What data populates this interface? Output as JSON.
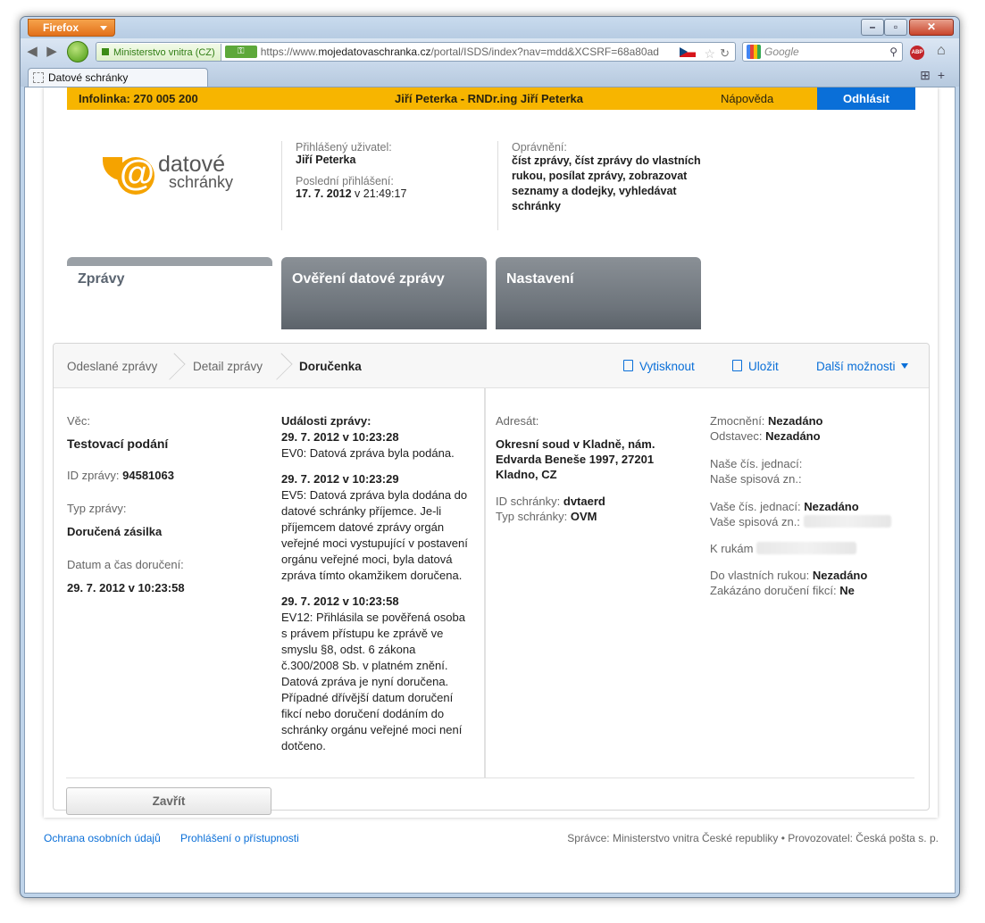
{
  "browser": {
    "app_button": "Firefox",
    "site_identity": "Ministerstvo vnitra (CZ)",
    "url_prefix": "https://www.",
    "url_domain": "mojedatovaschranka.cz",
    "url_rest": "/portal/ISDS/index?nav=mdd&XCSRF=68a80ad",
    "search_placeholder": "Google",
    "tab_title": "Datové schránky"
  },
  "topstrip": {
    "infoline": "Infolinka: 270 005 200",
    "user": "Jiří Peterka - RNDr.ing Jiří Peterka",
    "help": "Nápověda",
    "logout": "Odhlásit"
  },
  "logo": {
    "line1": "datové",
    "line2": "schránky"
  },
  "user_info": {
    "logged_label": "Přihlášený uživatel:",
    "logged_value": "Jiří Peterka",
    "last_label": "Poslední přihlášení:",
    "last_date": "17. 7. 2012",
    "last_time": " v 21:49:17",
    "rights_label": "Oprávnění:",
    "rights_value": "číst zprávy, číst zprávy do vlastních rukou, posílat zprávy, zobrazovat seznamy a dodejky, vyhledávat schránky"
  },
  "nav_tabs": [
    "Zprávy",
    "Ověření datové zprávy",
    "Nastavení"
  ],
  "breadcrumb": [
    "Odeslané zprávy",
    "Detail zprávy",
    "Doručenka"
  ],
  "actions": {
    "print": "Vytisknout",
    "save": "Uložit",
    "more": "Další možnosti"
  },
  "message": {
    "subject_label": "Věc:",
    "subject": "Testovací podání",
    "id_label": "ID zprávy:",
    "id": "94581063",
    "type_label": "Typ zprávy:",
    "type": "Doručená zásilka",
    "delivered_label": "Datum a čas doručení:",
    "delivered": "29. 7. 2012 v 10:23:58"
  },
  "events": {
    "title": "Události zprávy:",
    "items": [
      {
        "time": "29. 7. 2012 v 10:23:28",
        "text": "EV0: Datová zpráva byla podána."
      },
      {
        "time": "29. 7. 2012 v 10:23:29",
        "text": "EV5: Datová zpráva byla dodána do datové schránky příjemce. Je-li příjemcem datové zprávy orgán veřejné moci vystupující v postavení orgánu veřejné moci, byla datová zpráva tímto okamžikem doručena."
      },
      {
        "time": "29. 7. 2012 v 10:23:58",
        "text": "EV12: Přihlásila se pověřená osoba s právem přístupu ke zprávě ve smyslu §8, odst. 6 zákona č.300/2008 Sb. v platném znění. Datová zpráva je nyní doručena. Případné dřívější datum doručení fikcí nebo doručení dodáním do schránky orgánu veřejné moci není dotčeno."
      }
    ]
  },
  "recipient": {
    "label": "Adresát:",
    "address": "Okresní soud v Kladně, nám. Edvarda Beneše 1997, 27201 Kladno, CZ",
    "box_id_label": "ID schránky:",
    "box_id": "dvtaerd",
    "box_type_label": "Typ schránky:",
    "box_type": "OVM"
  },
  "details": {
    "authorized_label": "Zmocnění:",
    "authorized": "Nezadáno",
    "paragraph_label": "Odstavec:",
    "paragraph": "Nezadáno",
    "our_ref_label": "Naše čís. jednací:",
    "our_file_label": "Naše spisová zn.:",
    "your_ref_label": "Vaše čís. jednací:",
    "your_ref": "Nezadáno",
    "your_file_label": "Vaše spisová zn.:",
    "attn_label": "K rukám",
    "personal_label": "Do vlastních rukou:",
    "personal": "Nezadáno",
    "fiction_label": "Zakázáno doručení fikcí:",
    "fiction": "Ne"
  },
  "close_button": "Zavřít",
  "footer": {
    "privacy": "Ochrana osobních údajů",
    "accessibility": "Prohlášení o přístupnosti",
    "operator": "Správce: Ministerstvo vnitra České republiky • Provozovatel: Česká pošta s. p."
  }
}
